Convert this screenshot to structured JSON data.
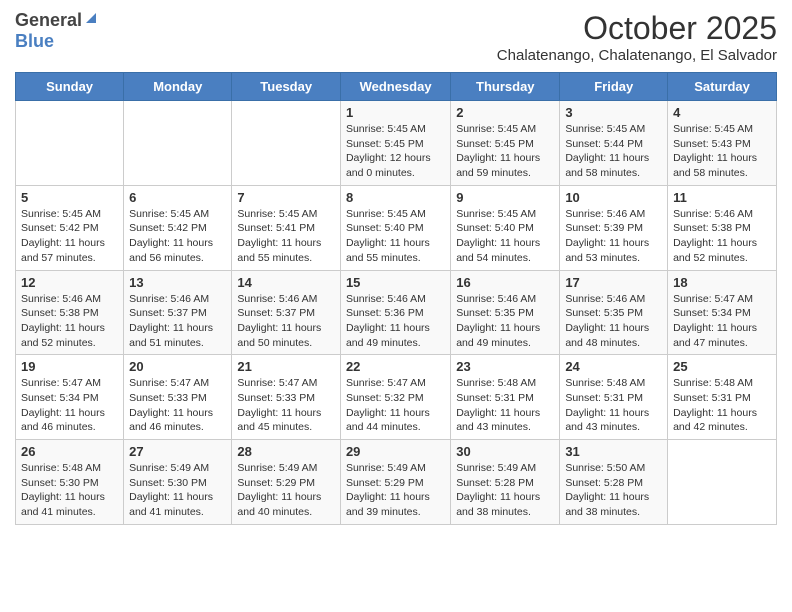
{
  "header": {
    "logo_general": "General",
    "logo_blue": "Blue",
    "month_title": "October 2025",
    "subtitle": "Chalatenango, Chalatenango, El Salvador"
  },
  "weekdays": [
    "Sunday",
    "Monday",
    "Tuesday",
    "Wednesday",
    "Thursday",
    "Friday",
    "Saturday"
  ],
  "weeks": [
    [
      {
        "day": "",
        "sunrise": "",
        "sunset": "",
        "daylight": ""
      },
      {
        "day": "",
        "sunrise": "",
        "sunset": "",
        "daylight": ""
      },
      {
        "day": "",
        "sunrise": "",
        "sunset": "",
        "daylight": ""
      },
      {
        "day": "1",
        "sunrise": "Sunrise: 5:45 AM",
        "sunset": "Sunset: 5:45 PM",
        "daylight": "Daylight: 12 hours and 0 minutes."
      },
      {
        "day": "2",
        "sunrise": "Sunrise: 5:45 AM",
        "sunset": "Sunset: 5:45 PM",
        "daylight": "Daylight: 11 hours and 59 minutes."
      },
      {
        "day": "3",
        "sunrise": "Sunrise: 5:45 AM",
        "sunset": "Sunset: 5:44 PM",
        "daylight": "Daylight: 11 hours and 58 minutes."
      },
      {
        "day": "4",
        "sunrise": "Sunrise: 5:45 AM",
        "sunset": "Sunset: 5:43 PM",
        "daylight": "Daylight: 11 hours and 58 minutes."
      }
    ],
    [
      {
        "day": "5",
        "sunrise": "Sunrise: 5:45 AM",
        "sunset": "Sunset: 5:42 PM",
        "daylight": "Daylight: 11 hours and 57 minutes."
      },
      {
        "day": "6",
        "sunrise": "Sunrise: 5:45 AM",
        "sunset": "Sunset: 5:42 PM",
        "daylight": "Daylight: 11 hours and 56 minutes."
      },
      {
        "day": "7",
        "sunrise": "Sunrise: 5:45 AM",
        "sunset": "Sunset: 5:41 PM",
        "daylight": "Daylight: 11 hours and 55 minutes."
      },
      {
        "day": "8",
        "sunrise": "Sunrise: 5:45 AM",
        "sunset": "Sunset: 5:40 PM",
        "daylight": "Daylight: 11 hours and 55 minutes."
      },
      {
        "day": "9",
        "sunrise": "Sunrise: 5:45 AM",
        "sunset": "Sunset: 5:40 PM",
        "daylight": "Daylight: 11 hours and 54 minutes."
      },
      {
        "day": "10",
        "sunrise": "Sunrise: 5:46 AM",
        "sunset": "Sunset: 5:39 PM",
        "daylight": "Daylight: 11 hours and 53 minutes."
      },
      {
        "day": "11",
        "sunrise": "Sunrise: 5:46 AM",
        "sunset": "Sunset: 5:38 PM",
        "daylight": "Daylight: 11 hours and 52 minutes."
      }
    ],
    [
      {
        "day": "12",
        "sunrise": "Sunrise: 5:46 AM",
        "sunset": "Sunset: 5:38 PM",
        "daylight": "Daylight: 11 hours and 52 minutes."
      },
      {
        "day": "13",
        "sunrise": "Sunrise: 5:46 AM",
        "sunset": "Sunset: 5:37 PM",
        "daylight": "Daylight: 11 hours and 51 minutes."
      },
      {
        "day": "14",
        "sunrise": "Sunrise: 5:46 AM",
        "sunset": "Sunset: 5:37 PM",
        "daylight": "Daylight: 11 hours and 50 minutes."
      },
      {
        "day": "15",
        "sunrise": "Sunrise: 5:46 AM",
        "sunset": "Sunset: 5:36 PM",
        "daylight": "Daylight: 11 hours and 49 minutes."
      },
      {
        "day": "16",
        "sunrise": "Sunrise: 5:46 AM",
        "sunset": "Sunset: 5:35 PM",
        "daylight": "Daylight: 11 hours and 49 minutes."
      },
      {
        "day": "17",
        "sunrise": "Sunrise: 5:46 AM",
        "sunset": "Sunset: 5:35 PM",
        "daylight": "Daylight: 11 hours and 48 minutes."
      },
      {
        "day": "18",
        "sunrise": "Sunrise: 5:47 AM",
        "sunset": "Sunset: 5:34 PM",
        "daylight": "Daylight: 11 hours and 47 minutes."
      }
    ],
    [
      {
        "day": "19",
        "sunrise": "Sunrise: 5:47 AM",
        "sunset": "Sunset: 5:34 PM",
        "daylight": "Daylight: 11 hours and 46 minutes."
      },
      {
        "day": "20",
        "sunrise": "Sunrise: 5:47 AM",
        "sunset": "Sunset: 5:33 PM",
        "daylight": "Daylight: 11 hours and 46 minutes."
      },
      {
        "day": "21",
        "sunrise": "Sunrise: 5:47 AM",
        "sunset": "Sunset: 5:33 PM",
        "daylight": "Daylight: 11 hours and 45 minutes."
      },
      {
        "day": "22",
        "sunrise": "Sunrise: 5:47 AM",
        "sunset": "Sunset: 5:32 PM",
        "daylight": "Daylight: 11 hours and 44 minutes."
      },
      {
        "day": "23",
        "sunrise": "Sunrise: 5:48 AM",
        "sunset": "Sunset: 5:31 PM",
        "daylight": "Daylight: 11 hours and 43 minutes."
      },
      {
        "day": "24",
        "sunrise": "Sunrise: 5:48 AM",
        "sunset": "Sunset: 5:31 PM",
        "daylight": "Daylight: 11 hours and 43 minutes."
      },
      {
        "day": "25",
        "sunrise": "Sunrise: 5:48 AM",
        "sunset": "Sunset: 5:31 PM",
        "daylight": "Daylight: 11 hours and 42 minutes."
      }
    ],
    [
      {
        "day": "26",
        "sunrise": "Sunrise: 5:48 AM",
        "sunset": "Sunset: 5:30 PM",
        "daylight": "Daylight: 11 hours and 41 minutes."
      },
      {
        "day": "27",
        "sunrise": "Sunrise: 5:49 AM",
        "sunset": "Sunset: 5:30 PM",
        "daylight": "Daylight: 11 hours and 41 minutes."
      },
      {
        "day": "28",
        "sunrise": "Sunrise: 5:49 AM",
        "sunset": "Sunset: 5:29 PM",
        "daylight": "Daylight: 11 hours and 40 minutes."
      },
      {
        "day": "29",
        "sunrise": "Sunrise: 5:49 AM",
        "sunset": "Sunset: 5:29 PM",
        "daylight": "Daylight: 11 hours and 39 minutes."
      },
      {
        "day": "30",
        "sunrise": "Sunrise: 5:49 AM",
        "sunset": "Sunset: 5:28 PM",
        "daylight": "Daylight: 11 hours and 38 minutes."
      },
      {
        "day": "31",
        "sunrise": "Sunrise: 5:50 AM",
        "sunset": "Sunset: 5:28 PM",
        "daylight": "Daylight: 11 hours and 38 minutes."
      },
      {
        "day": "",
        "sunrise": "",
        "sunset": "",
        "daylight": ""
      }
    ]
  ]
}
